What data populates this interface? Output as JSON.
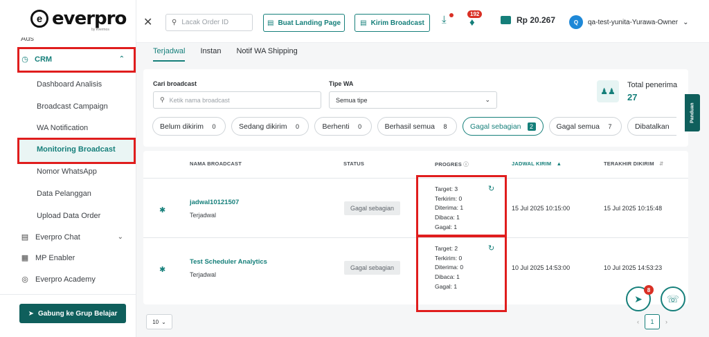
{
  "brand": {
    "name": "everpro",
    "sub": "by evermos",
    "mark": "e"
  },
  "sidebar": {
    "ads_label": "Ads",
    "crm": {
      "label": "CRM"
    },
    "crm_items": [
      "Dashboard Analisis",
      "Broadcast Campaign",
      "WA Notification",
      "Monitoring Broadcast",
      "Nomor WhatsApp",
      "Data Pelanggan",
      "Upload Data Order"
    ],
    "main_items": [
      "Everpro Chat",
      "MP Enabler",
      "Everpro Academy"
    ],
    "join_button": "Gabung ke Grup Belajar"
  },
  "header": {
    "search_placeholder": "Lacak Order ID",
    "landing_button": "Buat Landing Page",
    "broadcast_button": "Kirim Broadcast",
    "notif_count": "192",
    "balance": "Rp 20.267",
    "user_initial": "Q",
    "user_name": "qa-test-yunita-Yurawa-Owner"
  },
  "tabs": [
    "Terjadwal",
    "Instan",
    "Notif WA Shipping"
  ],
  "filters": {
    "search_label": "Cari broadcast",
    "search_placeholder": "Ketik nama broadcast",
    "type_label": "Tipe WA",
    "type_value": "Semua tipe",
    "total_label": "Total penerima",
    "total_value": "27"
  },
  "chips": [
    {
      "label": "Belum dikirim",
      "count": "0"
    },
    {
      "label": "Sedang dikirim",
      "count": "0"
    },
    {
      "label": "Berhenti",
      "count": "0"
    },
    {
      "label": "Berhasil semua",
      "count": "8"
    },
    {
      "label": "Gagal sebagian",
      "count": "2"
    },
    {
      "label": "Gagal semua",
      "count": "7"
    },
    {
      "label": "Dibatalkan",
      "count": ""
    }
  ],
  "panduan": "Panduan",
  "table": {
    "headers": [
      "NAMA BROADCAST",
      "STATUS",
      "PROGRES",
      "JADWAL KIRIM",
      "TERAKHIR DIKIRIM"
    ],
    "rows": [
      {
        "name": "jadwal10121507",
        "sub": "Terjadwal",
        "status": "Gagal sebagian",
        "progress": [
          "Target: 3",
          "Terkirim: 0",
          "Diterima: 1",
          "Dibaca: 1",
          "Gagal: 1"
        ],
        "jadwal": "15 Jul 2025 10:15:00",
        "terakhir": "15 Jul 2025 10:15:48"
      },
      {
        "name": "Test Scheduler Analytics",
        "sub": "Terjadwal",
        "status": "Gagal sebagian",
        "progress": [
          "Target: 2",
          "Terkirim: 0",
          "Diterima: 0",
          "Dibaca: 1",
          "Gagal: 1"
        ],
        "jadwal": "10 Jul 2025 14:53:00",
        "terakhir": "10 Jul 2025 14:53:23"
      }
    ]
  },
  "pagination": {
    "per_page": "10",
    "current": "1"
  },
  "fab": {
    "badge": "8"
  }
}
